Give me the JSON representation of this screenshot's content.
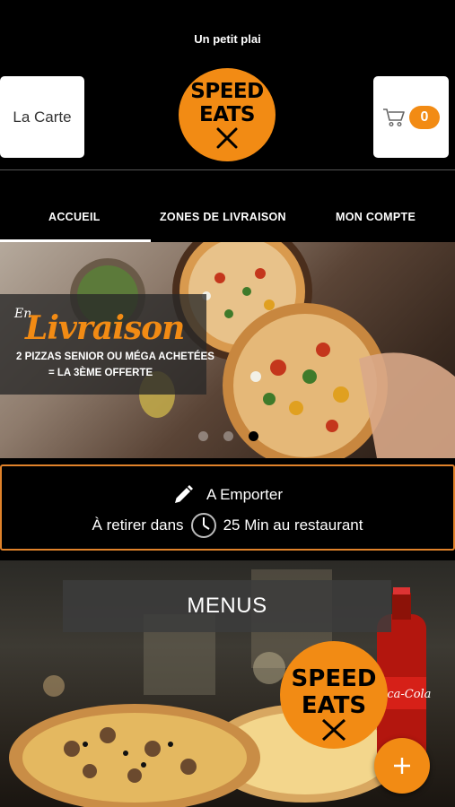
{
  "header": {
    "tagline": "Un petit plai",
    "left_button_label": "La Carte",
    "cart_count": "0",
    "logo_line1": "SPEED",
    "logo_line2": "EATS"
  },
  "nav": {
    "items": [
      {
        "label": "ACCUEIL",
        "active": true
      },
      {
        "label": "ZONES DE LIVRAISON",
        "active": false
      },
      {
        "label": "MON COMPTE",
        "active": false
      }
    ]
  },
  "banner": {
    "en": "En",
    "title": "Livraison",
    "line1": "2 PIZZAS SENIOR OU MÉGA ACHETÉES",
    "line2": "= LA 3ÈME OFFERTE",
    "slides": 3,
    "active_slide": 3
  },
  "pickup": {
    "mode_label": "A Emporter",
    "prefix": "À retirer dans",
    "suffix": "25 Min au restaurant"
  },
  "menus": {
    "title": "MENUS",
    "logo_line1": "SPEED",
    "logo_line2": "EATS",
    "bottle_label": "Coca-Cola"
  },
  "colors": {
    "accent": "#f28b14",
    "background": "#000000",
    "border": "#e0822a"
  }
}
